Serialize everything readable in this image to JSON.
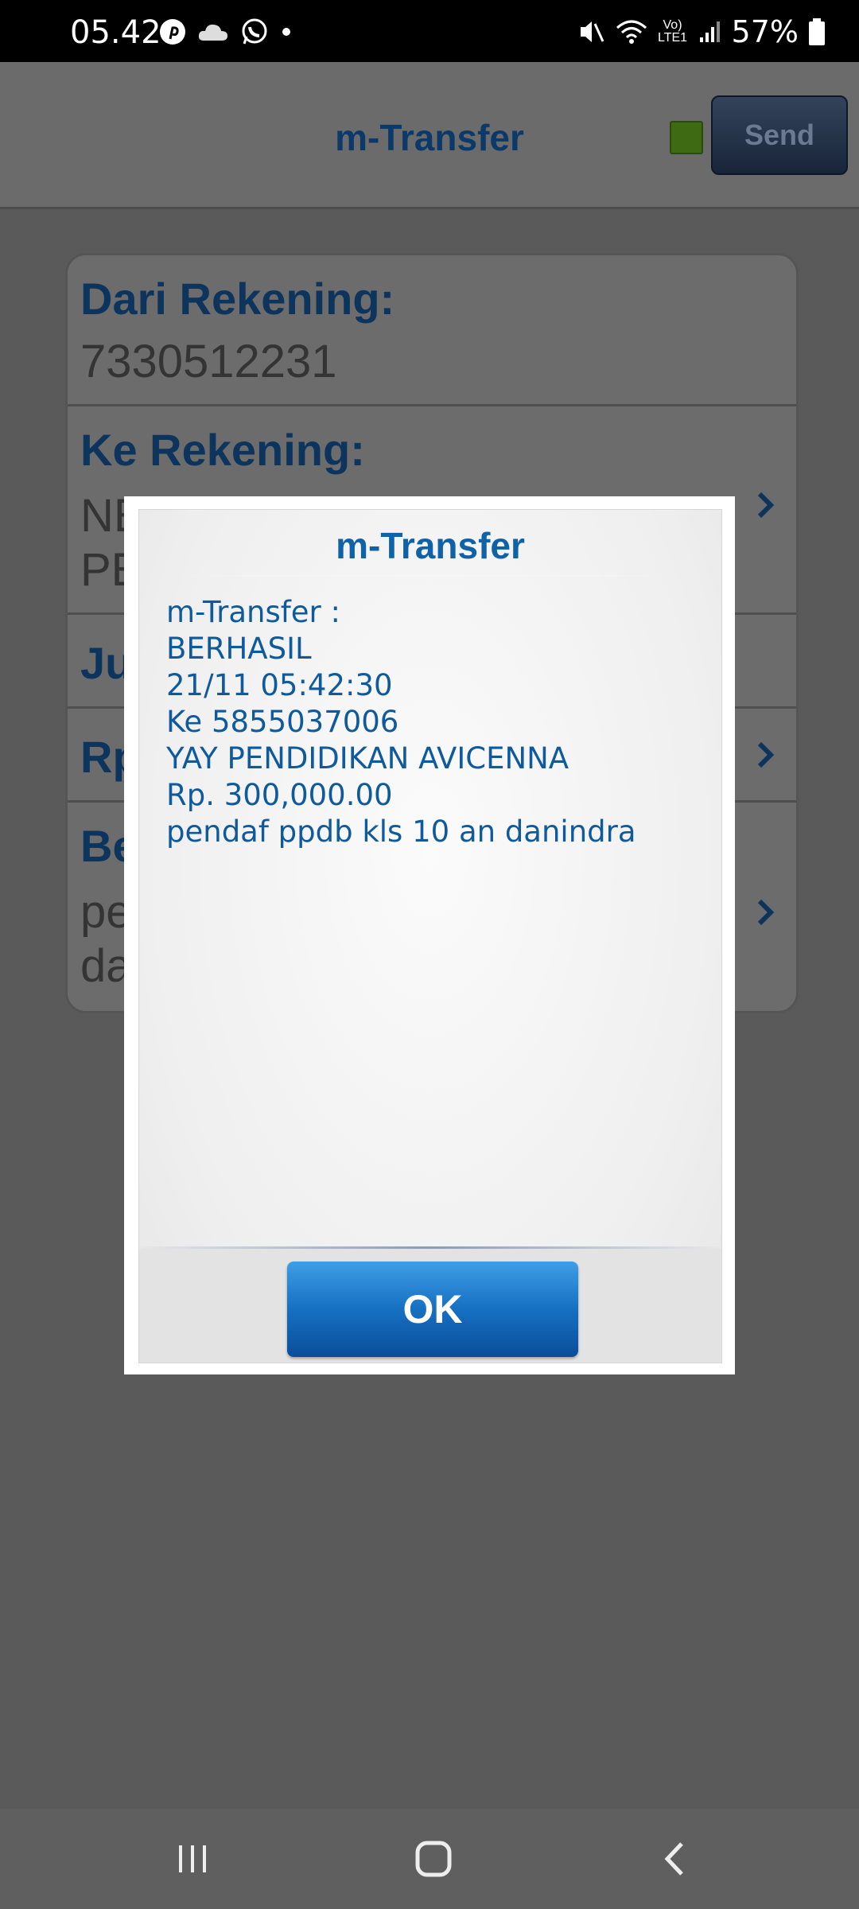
{
  "status_bar": {
    "time": "05.42",
    "left_icons": [
      "pinterest-icon",
      "cloud-icon",
      "whatsapp-icon",
      "dot-icon"
    ],
    "right_icons": [
      "mute-icon",
      "wifi-icon",
      "volte-icon",
      "signal-icon",
      "battery-icon"
    ],
    "volte_label": "Vo) LTE1",
    "battery": "57%"
  },
  "header": {
    "title": "m-Transfer",
    "send_label": "Send",
    "status_color": "#3d6a12"
  },
  "form": {
    "from_label": "Dari Rekening:",
    "from_value": "7330512231",
    "to_label": "Ke Rekening:",
    "to_value_line1": "NE",
    "to_value_line2": "PE",
    "jumlah_label": "Ju",
    "rp_label": "Rp",
    "berita_label": "Be",
    "berita_value_line1": "pe",
    "berita_value_line2": "da"
  },
  "dialog": {
    "title": "m-Transfer",
    "lines": [
      "m-Transfer :",
      "BERHASIL",
      "21/11 05:42:30",
      "Ke 5855037006",
      "YAY PENDIDIKAN AVICENNA",
      "Rp. 300,000.00",
      "pendaf ppdb kls 10 an danindra"
    ],
    "ok_label": "OK"
  },
  "nav": {
    "items": [
      "recent-apps-icon",
      "home-icon",
      "back-icon"
    ]
  }
}
